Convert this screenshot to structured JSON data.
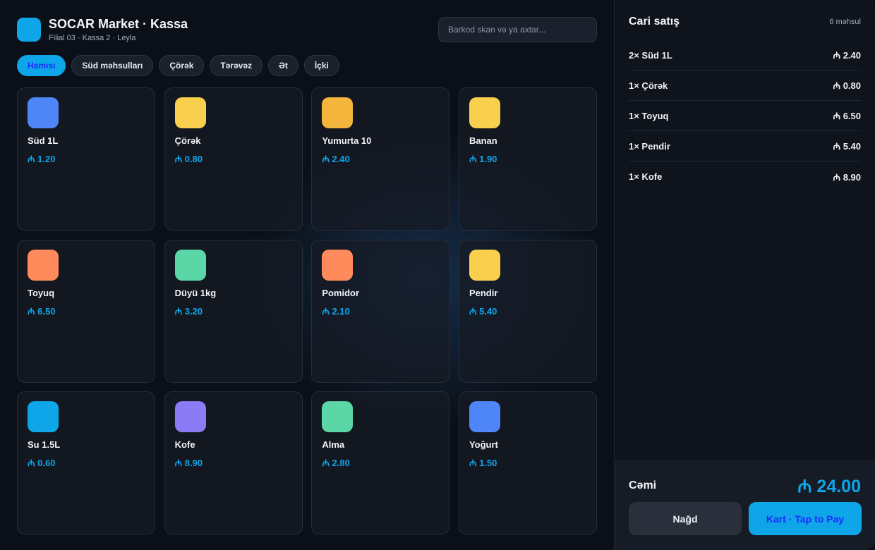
{
  "header": {
    "title": "SOCAR Market · Kassa",
    "subtitle": "Filial 03 · Kassa 2 · Leyla"
  },
  "search": {
    "placeholder": "Barkod skan və ya axtar..."
  },
  "categories": [
    {
      "label": "Hamısı",
      "active": true
    },
    {
      "label": "Süd məhsulları",
      "active": false
    },
    {
      "label": "Çörək",
      "active": false
    },
    {
      "label": "Tərəvəz",
      "active": false
    },
    {
      "label": "Ət",
      "active": false
    },
    {
      "label": "İçki",
      "active": false
    }
  ],
  "products": [
    {
      "name": "Süd 1L",
      "price": "₼ 1.20",
      "color": "#4f86f7"
    },
    {
      "name": "Çörək",
      "price": "₼ 0.80",
      "color": "#f8d04e"
    },
    {
      "name": "Yumurta 10",
      "price": "₼ 2.40",
      "color": "#f4b53c"
    },
    {
      "name": "Banan",
      "price": "₼ 1.90",
      "color": "#f8d04e"
    },
    {
      "name": "Toyuq",
      "price": "₼ 6.50",
      "color": "#ff8a5c"
    },
    {
      "name": "Düyü 1kg",
      "price": "₼ 3.20",
      "color": "#5bd6a6"
    },
    {
      "name": "Pomidor",
      "price": "₼ 2.10",
      "color": "#ff8a5c"
    },
    {
      "name": "Pendir",
      "price": "₼ 5.40",
      "color": "#f8d04e"
    },
    {
      "name": "Su 1.5L",
      "price": "₼ 0.60",
      "color": "#0ea5e9"
    },
    {
      "name": "Kofe",
      "price": "₼ 8.90",
      "color": "#8b7cf6"
    },
    {
      "name": "Alma",
      "price": "₼ 2.80",
      "color": "#5bd6a6"
    },
    {
      "name": "Yoğurt",
      "price": "₼ 1.50",
      "color": "#4f86f7"
    }
  ],
  "cart": {
    "title": "Cari satış",
    "count": "6 məhsul",
    "items": [
      {
        "label": "2× Süd 1L",
        "amount": "₼ 2.40"
      },
      {
        "label": "1× Çörək",
        "amount": "₼ 0.80"
      },
      {
        "label": "1× Toyuq",
        "amount": "₼ 6.50"
      },
      {
        "label": "1× Pendir",
        "amount": "₼ 5.40"
      },
      {
        "label": "1× Kofe",
        "amount": "₼ 8.90"
      }
    ],
    "total_label": "Cəmi",
    "total_value": "₼ 24.00",
    "cash_label": "Nağd",
    "card_label": "Kart · Tap to Pay"
  },
  "colors": {
    "accent": "#0ea5e9",
    "accent_text": "#1b2cff",
    "background": "#0b0f17",
    "panel": "#0e131c"
  }
}
